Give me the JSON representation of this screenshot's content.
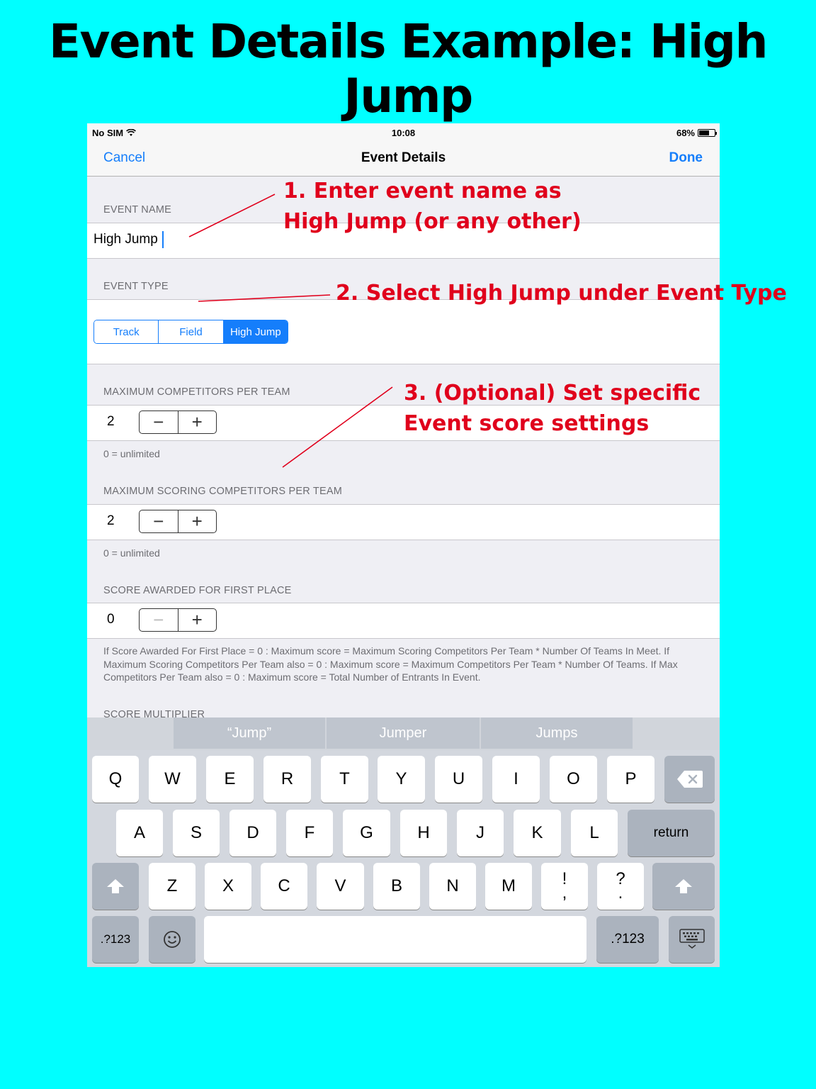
{
  "headline": "Event Details Example: High Jump",
  "status_bar": {
    "carrier": "No SIM",
    "time": "10:08",
    "battery": "68%",
    "battery_level": 0.68
  },
  "nav": {
    "cancel": "Cancel",
    "title": "Event Details",
    "done": "Done"
  },
  "event_name": {
    "header": "EVENT NAME",
    "value": "High Jump"
  },
  "event_type": {
    "header": "EVENT TYPE",
    "options": [
      "Track",
      "Field",
      "High Jump"
    ],
    "selected": "High Jump"
  },
  "max_competitors": {
    "header": "MAXIMUM COMPETITORS PER TEAM",
    "value": "2",
    "footer": "0 = unlimited"
  },
  "max_scoring": {
    "header": "MAXIMUM SCORING COMPETITORS PER TEAM",
    "value": "2",
    "footer": "0 = unlimited"
  },
  "first_place": {
    "header": "SCORE AWARDED FOR FIRST PLACE",
    "value": "0"
  },
  "stepper": {
    "minus": "−",
    "plus": "+"
  },
  "score_note": "If Score Awarded For First Place = 0 : Maximum score = Maximum Scoring Competitors Per Team * Number Of Teams In Meet. If Maximum Scoring Competitors Per Team also = 0 : Maximum score = Maximum Competitors Per Team * Number Of Teams.  If Max Competitors Per Team also = 0 : Maximum score = Total Number of Entrants In Event.",
  "score_multiplier_header": "SCORE MULTIPLIER",
  "suggestions": [
    "“Jump”",
    "Jumper",
    "Jumps"
  ],
  "keyboard": {
    "row1": [
      "Q",
      "W",
      "E",
      "R",
      "T",
      "Y",
      "U",
      "I",
      "O",
      "P"
    ],
    "row2": [
      "A",
      "S",
      "D",
      "F",
      "G",
      "H",
      "J",
      "K",
      "L"
    ],
    "row3": [
      "Z",
      "X",
      "C",
      "V",
      "B",
      "N",
      "M"
    ],
    "punct1": [
      "!",
      ","
    ],
    "punct2": [
      "?",
      "."
    ],
    "return": "return",
    "numbers": ".?123"
  },
  "annotations": {
    "step1_line1": "1. Enter event name as",
    "step1_line2": "High Jump (or any other)",
    "step2": "2. Select High Jump  under Event Type",
    "step3_line1": "3. (Optional) Set specific",
    "step3_line2": "Event score settings"
  }
}
